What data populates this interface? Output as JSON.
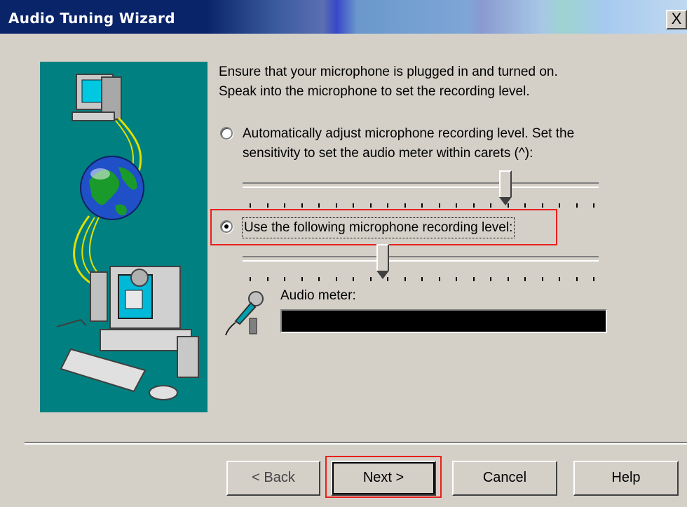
{
  "window": {
    "title": "Audio Tuning Wizard",
    "close_glyph": "X"
  },
  "instructions": [
    "Ensure that your microphone is plugged in and turned on.",
    "Speak into the microphone to set the recording level."
  ],
  "options": {
    "auto": {
      "line1": "Automatically adjust microphone recording level. Set the",
      "line2": "sensitivity to set the audio meter within carets (^):",
      "selected": false,
      "sensitivity_level": 0.75
    },
    "manual": {
      "label": "Use the following microphone recording level:",
      "selected": true,
      "recording_level": 0.4
    }
  },
  "audio_meter": {
    "label": "Audio meter:",
    "level": 0
  },
  "buttons": {
    "back": "< Back",
    "next": "Next >",
    "cancel": "Cancel",
    "help": "Help"
  },
  "colors": {
    "illustration_bg": "#008080",
    "highlight": "#e8201e",
    "meter_bg": "#000000"
  },
  "icons": [
    "illustration-computer-globe",
    "microphone-icon"
  ]
}
